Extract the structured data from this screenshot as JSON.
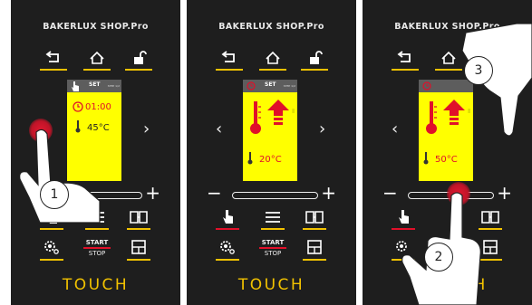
{
  "colors": {
    "panel_bg": "#1e1e1e",
    "accent_yellow": "#f2c200",
    "accent_red": "#e0102a",
    "screen_yellow": "#ffff00"
  },
  "panels": [
    {
      "brand": "BAKERLUX SHOP.Pro",
      "screen": {
        "title": "SET",
        "step": "STEP 1/2",
        "time": "01:00",
        "temp": "45°C"
      },
      "start_label": "START",
      "stop_label": "STOP",
      "touch_label": "TOUCH",
      "step_marker": "1"
    },
    {
      "brand": "BAKERLUX SHOP.Pro",
      "screen": {
        "title": "SET",
        "step": "STEP 1/2",
        "temp": "20°C"
      },
      "start_label": "START",
      "stop_label": "STOP",
      "touch_label": "TOUCH"
    },
    {
      "brand": "BAKERLUX SHOP.Pro",
      "screen": {
        "temp": "50°C"
      },
      "start_label": "START",
      "stop_label": "STOP",
      "touch_label": "UCH",
      "step_markers": [
        "3",
        "2"
      ]
    }
  ],
  "icons": [
    "back-icon",
    "home-icon",
    "unlock-icon",
    "finger-touch-icon",
    "menu-icon",
    "book-icon",
    "settings-icon",
    "save-icon",
    "clock-icon",
    "thermometer-icon",
    "arrow-up-icon",
    "hand-pointer-icon"
  ]
}
